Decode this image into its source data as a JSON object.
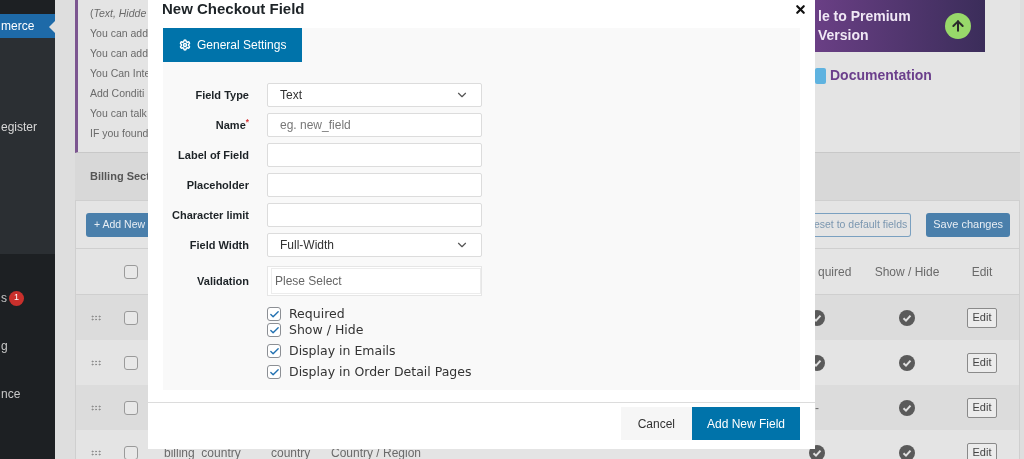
{
  "sidebar": {
    "items": [
      {
        "label": "merce",
        "selected": true,
        "submenu": [
          {
            "label": "egister"
          }
        ]
      },
      {
        "label": "s",
        "selected": false,
        "badge": "1"
      },
      {
        "label": "g",
        "selected": false
      },
      {
        "label": "nce",
        "selected": false
      }
    ]
  },
  "notice": {
    "lines": [
      "(*Text, Hidde*",
      "You can add",
      "You can add",
      "You Can Inte",
      "Add Conditi",
      "You can talk",
      "IF you found"
    ]
  },
  "premium_banner": {
    "lines": [
      "le to Premium",
      "Version"
    ]
  },
  "documentation_link": "Documentation",
  "section_tab": "Billing Sect",
  "toolbar": {
    "add_button": "+ Add New",
    "reset_button": "eset to default fields",
    "save_button": "Save changes"
  },
  "table": {
    "header_checked": false,
    "columns": [
      "quired",
      "Show / Hide",
      "Edit"
    ],
    "rows": [
      {
        "checked": false,
        "required": true,
        "shown": true,
        "edit": "Edit"
      },
      {
        "checked": false,
        "required": true,
        "shown": true,
        "edit": "Edit"
      },
      {
        "checked": false,
        "required": false,
        "required_text": "-",
        "shown": true,
        "edit": "Edit"
      },
      {
        "checked": false,
        "required": true,
        "shown": true,
        "edit": "Edit",
        "cells": [
          "billing_country",
          "country",
          "Country / Region"
        ]
      }
    ]
  },
  "modal": {
    "title": "New Checkout Field",
    "tabs": [
      {
        "label": "General Settings",
        "selected": true
      }
    ],
    "fields": [
      {
        "label": "Field Type",
        "kind": "select",
        "value": "Text"
      },
      {
        "label": "Name$^{*}$",
        "kind": "text",
        "placeholder": "eg. new_field"
      },
      {
        "label": "Label of Field",
        "kind": "text"
      },
      {
        "label": "Placeholder",
        "kind": "text"
      },
      {
        "label": "Character limit",
        "kind": "text"
      },
      {
        "label": "Field Width",
        "kind": "select",
        "value": "Full-Width"
      },
      {
        "label": "Validation",
        "kind": "multiselect",
        "placeholder": "Plese Select"
      }
    ],
    "checkboxes": [
      {
        "label": "Required",
        "checked": true
      },
      {
        "label": "Show / Hide",
        "checked": true
      },
      {
        "label": "Display in Emails",
        "checked": true
      },
      {
        "label": "Display in Order Detail Pages",
        "checked": true
      }
    ],
    "cancel_button": "Cancel",
    "submit_button": "Add New Field"
  }
}
